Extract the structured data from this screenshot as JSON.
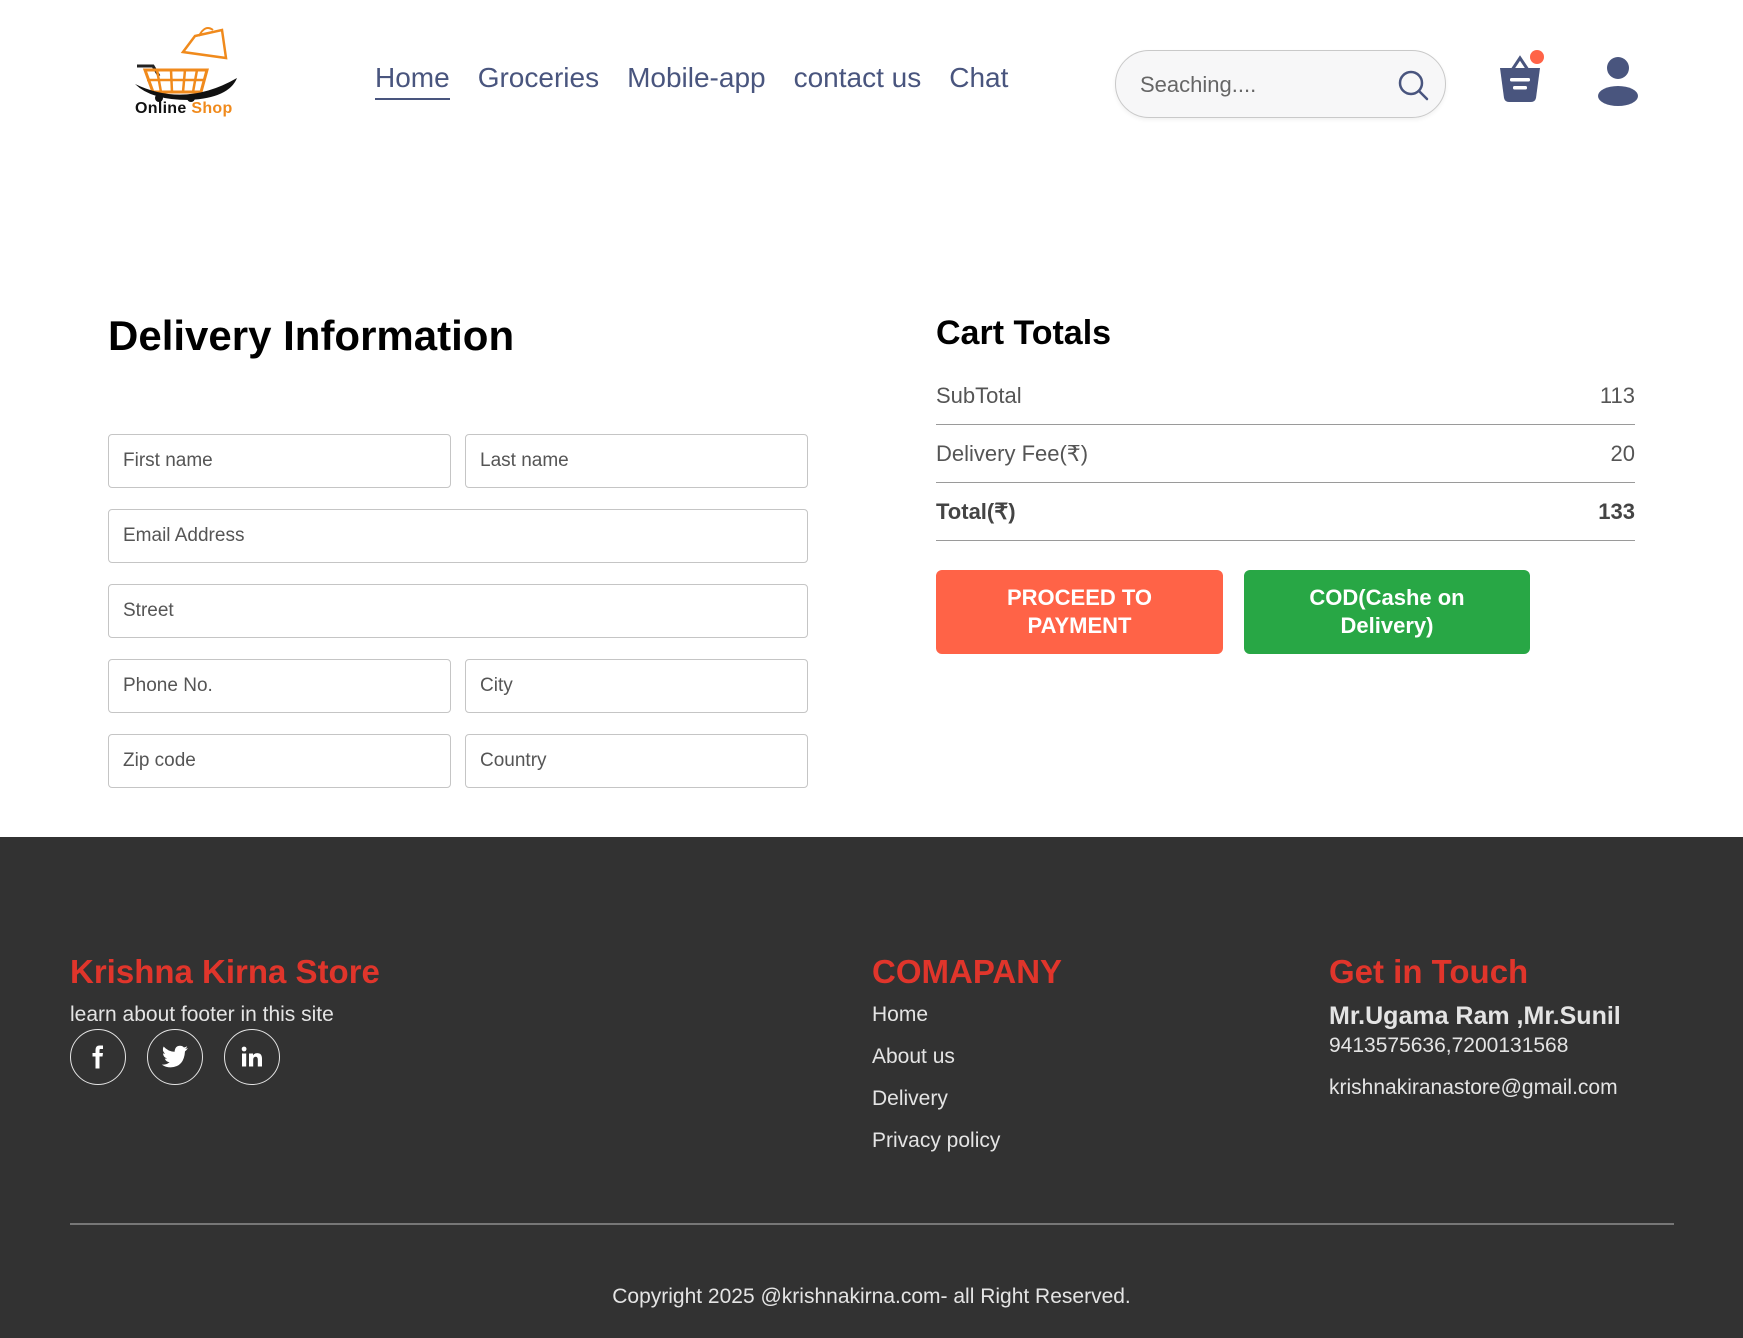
{
  "brand": {
    "logo_primary": "Online",
    "logo_accent": "Shop",
    "accent_color": "#f08a1c"
  },
  "nav": {
    "items": [
      {
        "label": "Home",
        "active": true
      },
      {
        "label": "Groceries"
      },
      {
        "label": "Mobile-app"
      },
      {
        "label": "contact us"
      },
      {
        "label": "Chat"
      }
    ],
    "color": "#49557e"
  },
  "search": {
    "placeholder": "Seaching....",
    "icon": "search-icon"
  },
  "header_icons": {
    "cart": "basket-icon",
    "cart_badge_color": "#ff6347",
    "profile": "profile-icon"
  },
  "delivery": {
    "title": "Delivery Information",
    "fields": {
      "first_name": "First name",
      "last_name": "Last name",
      "email": "Email Address",
      "street": "Street",
      "phone": "Phone No.",
      "city": "City",
      "zip": "Zip code",
      "country": "Country"
    }
  },
  "cart": {
    "title": "Cart Totals",
    "subtotal_label": "SubTotal",
    "subtotal_value": "113",
    "delivery_label": "Delivery Fee(₹)",
    "delivery_value": "20",
    "total_label": "Total(₹)",
    "total_value": "133",
    "pay_button": "PROCEED TO PAYMENT",
    "cod_button": "COD(Cashe on Delivery)",
    "pay_color": "#ff6347",
    "cod_color": "#28a745"
  },
  "footer": {
    "store_title": "Krishna Kirna Store",
    "store_tagline": "learn about footer in this site",
    "social": [
      "facebook-icon",
      "twitter-icon",
      "linkedin-icon"
    ],
    "company_title": "COMAPANY",
    "company_links": [
      "Home",
      "About us",
      "Delivery",
      "Privacy policy"
    ],
    "contact_title": "Get in Touch",
    "contact_names": "Mr.Ugama Ram ,Mr.Sunil",
    "contact_phones": "9413575636,7200131568",
    "contact_email": "krishnakiranastore@gmail.com",
    "copyright": "Copyright 2025 @krishnakirna.com- all Right Reserved.",
    "heading_color": "#e0352b",
    "background_color": "#323232"
  }
}
